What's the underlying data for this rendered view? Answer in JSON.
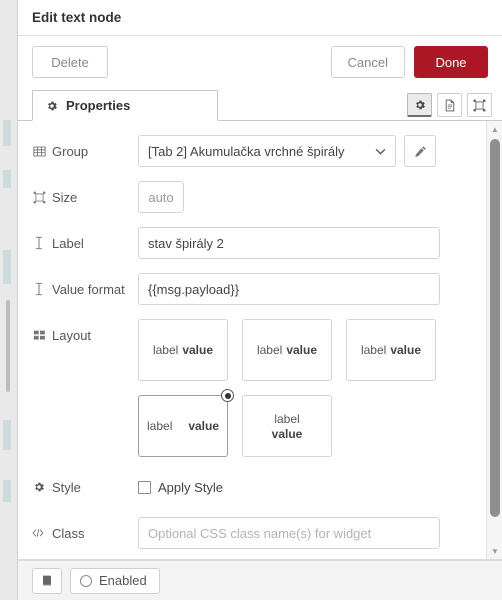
{
  "dialog": {
    "title": "Edit text node",
    "actions": {
      "delete_label": "Delete",
      "cancel_label": "Cancel",
      "done_label": "Done"
    },
    "done_color": "#ad1625"
  },
  "tabs": [
    {
      "label": "Properties",
      "icon": "gear-icon",
      "active": true
    }
  ],
  "tab_icon_buttons": [
    {
      "name": "gear-icon",
      "active": true
    },
    {
      "name": "description-icon",
      "active": false
    },
    {
      "name": "resize-icon",
      "active": false
    }
  ],
  "form": {
    "group": {
      "label": "Group",
      "icon": "table-icon",
      "value": "[Tab 2] Akumulačka vrchné špirály",
      "caret": "⌄",
      "edit_button": "pencil-icon"
    },
    "size": {
      "label": "Size",
      "icon": "resize-icon",
      "value": "auto"
    },
    "label_field": {
      "label": "Label",
      "icon": "text-cursor-icon",
      "value": "stav špirály 2"
    },
    "value_format": {
      "label": "Value format",
      "icon": "text-cursor-icon",
      "value": "{{msg.payload}}"
    },
    "layout": {
      "label": "Layout",
      "icon": "grid-icon",
      "selected_index": 3,
      "options": [
        {
          "arrangement": "inline-left",
          "label_text": "label",
          "value_text": "value"
        },
        {
          "arrangement": "inline-center",
          "label_text": "label",
          "value_text": "value"
        },
        {
          "arrangement": "inline-right",
          "label_text": "label",
          "value_text": "value"
        },
        {
          "arrangement": "spread",
          "label_text": "label",
          "value_text": "value"
        },
        {
          "arrangement": "stacked",
          "label_text": "label",
          "value_text": "value"
        }
      ]
    },
    "style": {
      "label": "Style",
      "icon": "gear-icon",
      "checkbox_label": "Apply Style",
      "checked": false
    },
    "class_field": {
      "label": "Class",
      "icon": "code-icon",
      "value": "",
      "placeholder": "Optional CSS class name(s) for widget"
    }
  },
  "footer": {
    "docs_button": "book-icon",
    "enabled_toggle": "Enabled"
  },
  "scrollbar": {
    "up_arrow": "▲",
    "down_arrow": "▼"
  }
}
